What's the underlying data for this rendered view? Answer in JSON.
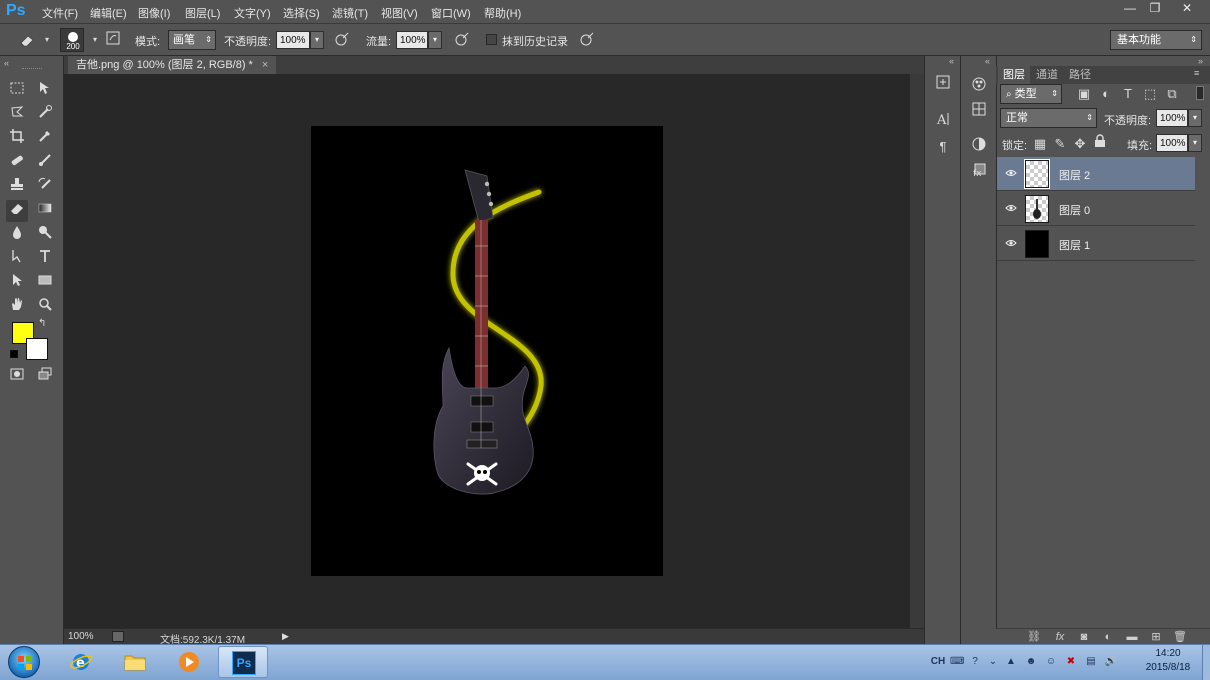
{
  "app": {
    "logo": "Ps",
    "menu": [
      "文件(F)",
      "编辑(E)",
      "图像(I)",
      "图层(L)",
      "文字(Y)",
      "选择(S)",
      "滤镜(T)",
      "视图(V)",
      "窗口(W)",
      "帮助(H)"
    ],
    "window_controls": {
      "minimize": "—",
      "restore": "❐",
      "close": "✕"
    }
  },
  "options": {
    "brush_size": "200",
    "mode_label": "模式:",
    "mode_value": "画笔",
    "opacity_label": "不透明度:",
    "opacity_value": "100%",
    "flow_label": "流量:",
    "flow_value": "100%",
    "erase_history_label": "抹到历史记录",
    "workspace": "基本功能"
  },
  "document": {
    "tab_title": "吉他.png @ 100% (图层 2, RGB/8) *",
    "tab_close": "×",
    "zoom": "100%",
    "doc_info": "文档:592.3K/1.37M"
  },
  "colors": {
    "foreground": "#ffff11",
    "background": "#ffffff",
    "accent": "#31a8ff",
    "selected_layer": "#6b7a93"
  },
  "layers_panel": {
    "tabs": [
      "图层",
      "通道",
      "路径"
    ],
    "active_tab": 0,
    "filter_kind": "类型",
    "blend_mode": "正常",
    "opacity_label": "不透明度:",
    "opacity_value": "100%",
    "lock_label": "锁定:",
    "fill_label": "填充:",
    "fill_value": "100%",
    "layers": [
      {
        "name": "图层 2",
        "selected": true,
        "thumb": "transparent"
      },
      {
        "name": "图层 0",
        "selected": false,
        "thumb": "guitar"
      },
      {
        "name": "图层 1",
        "selected": false,
        "thumb": "black"
      }
    ]
  },
  "taskbar": {
    "apps": [
      "start-orb",
      "ie-icon",
      "explorer-icon",
      "media-player-icon",
      "photoshop-icon"
    ],
    "active_app": "Ps",
    "input_lang": "CH",
    "time": "14:20",
    "date": "2015/8/18"
  }
}
